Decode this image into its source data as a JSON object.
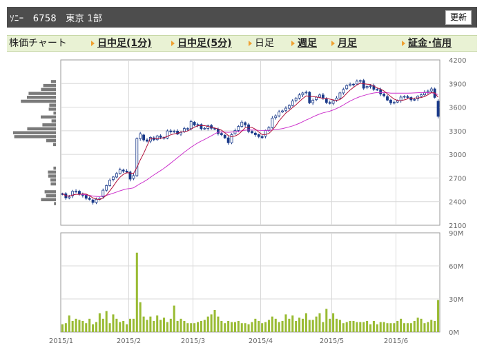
{
  "header": {
    "title": "ｿﾆｰ　6758　東京 1部",
    "refresh_label": "更新"
  },
  "tabs": [
    {
      "label": "株価チャート",
      "link": false,
      "arrow": false
    },
    {
      "label": "日中足(1分)",
      "link": true,
      "arrow": true
    },
    {
      "label": "日中足(5分)",
      "link": true,
      "arrow": true
    },
    {
      "label": "日足",
      "link": false,
      "arrow": true
    },
    {
      "label": "週足",
      "link": true,
      "arrow": true
    },
    {
      "label": "月足",
      "link": true,
      "arrow": true
    },
    {
      "label": "証金･信用",
      "link": true,
      "arrow": true
    }
  ],
  "colors": {
    "up": "#ffffff",
    "down": "#1a3a8a",
    "ma_short": "#b0103a",
    "ma_long": "#cc33cc",
    "volume": "#99bb33",
    "profile": "#7a7a7a",
    "grid": "#d8d8d8"
  },
  "chart_data": [
    {
      "type": "candlestick",
      "ylim": [
        2100,
        4200
      ],
      "ytick_labels": [
        "4200",
        "3900",
        "3600",
        "3300",
        "3000",
        "2700",
        "2400",
        "2100"
      ],
      "yticks": [
        4200,
        3900,
        3600,
        3300,
        3000,
        2700,
        2400,
        2100
      ],
      "xtick_labels": [
        "2015/1",
        "2015/2",
        "2015/3",
        "2015/4",
        "2015/5",
        "2015/6"
      ],
      "xtick_index": [
        0,
        20,
        39,
        59,
        80,
        99
      ],
      "close": [
        2501,
        2447,
        2459,
        2531,
        2532,
        2493,
        2480,
        2442,
        2429,
        2389,
        2429,
        2441,
        2545,
        2604,
        2673,
        2713,
        2757,
        2804,
        2788,
        2776,
        2686,
        2730,
        3200,
        3262,
        3184,
        3168,
        3216,
        3187,
        3235,
        3218,
        3205,
        3298,
        3287,
        3295,
        3258,
        3279,
        3328,
        3327,
        3417,
        3373,
        3379,
        3326,
        3330,
        3366,
        3332,
        3321,
        3266,
        3251,
        3210,
        3148,
        3252,
        3304,
        3355,
        3410,
        3376,
        3292,
        3275,
        3251,
        3227,
        3212,
        3303,
        3341,
        3461,
        3490,
        3539,
        3552,
        3587,
        3621,
        3678,
        3714,
        3756,
        3780,
        3790,
        3655,
        3688,
        3728,
        3755,
        3720,
        3659,
        3648,
        3681,
        3716,
        3781,
        3824,
        3875,
        3891,
        3886,
        3930,
        3938,
        3841,
        3863,
        3872,
        3826,
        3822,
        3767,
        3745,
        3690,
        3654,
        3660,
        3682,
        3728,
        3737,
        3723,
        3693,
        3697,
        3740,
        3757,
        3788,
        3805,
        3832,
        3724,
        3483
      ],
      "series": [
        {
          "name": "",
          "values": []
        },
        {
          "name": "",
          "values": []
        }
      ]
    },
    {
      "type": "bar",
      "ylim": [
        0,
        90
      ],
      "ytick_labels": [
        "90M",
        "60M",
        "30M",
        "0M"
      ],
      "yticks": [
        90,
        60,
        30,
        0
      ],
      "values": [
        7,
        8,
        15,
        10,
        12,
        11,
        10,
        8,
        12,
        7,
        9,
        17,
        12,
        19,
        8,
        16,
        12,
        9,
        10,
        7,
        12,
        12,
        72,
        27,
        14,
        11,
        14,
        10,
        15,
        11,
        13,
        9,
        12,
        24,
        10,
        12,
        10,
        8,
        8,
        8,
        9,
        10,
        11,
        14,
        16,
        20,
        14,
        10,
        8,
        10,
        9,
        9,
        10,
        8,
        8,
        7,
        9,
        12,
        10,
        8,
        9,
        11,
        14,
        12,
        9,
        10,
        16,
        12,
        15,
        10,
        13,
        12,
        17,
        11,
        11,
        14,
        17,
        9,
        21,
        12,
        17,
        12,
        11,
        8,
        9,
        10,
        10,
        9,
        9,
        9,
        10,
        7,
        10,
        7,
        9,
        9,
        8,
        8,
        8,
        10,
        12,
        8,
        8,
        8,
        10,
        13,
        12,
        8,
        9,
        11,
        10,
        29
      ]
    }
  ]
}
